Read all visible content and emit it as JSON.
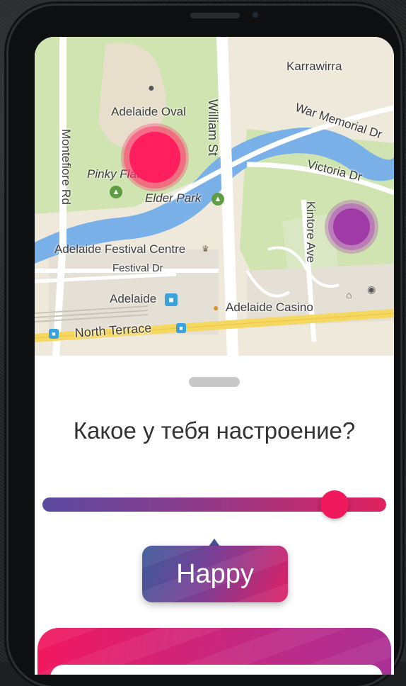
{
  "map": {
    "labels": {
      "karrawirra": "Karrawirra",
      "adelaide_oval": "Adelaide Oval",
      "william_st": "William St",
      "war_memorial": "War Memorial Dr",
      "montefiore": "Montefiore Rd",
      "victoria": "Victoria Dr",
      "pinky_flat": "Pinky Flat",
      "elder_park": "Elder Park",
      "kintore": "Kintore Ave",
      "festival_centre": "Adelaide Festival Centre",
      "festival_dr": "Festival Dr",
      "adelaide_station": "Adelaide",
      "casino": "Adelaide Casino",
      "north_terrace": "North Terrace"
    },
    "colors": {
      "water": "#79b0e8",
      "park": "#cfe4b0",
      "road_major": "#f6d760",
      "road": "#ffffff",
      "marker_primary": "#ff1f5e",
      "marker_secondary": "#a03aa6"
    }
  },
  "mood": {
    "question": "Какое у тебя настроение?",
    "value_label": "Happy",
    "slider_value": 0.85
  }
}
